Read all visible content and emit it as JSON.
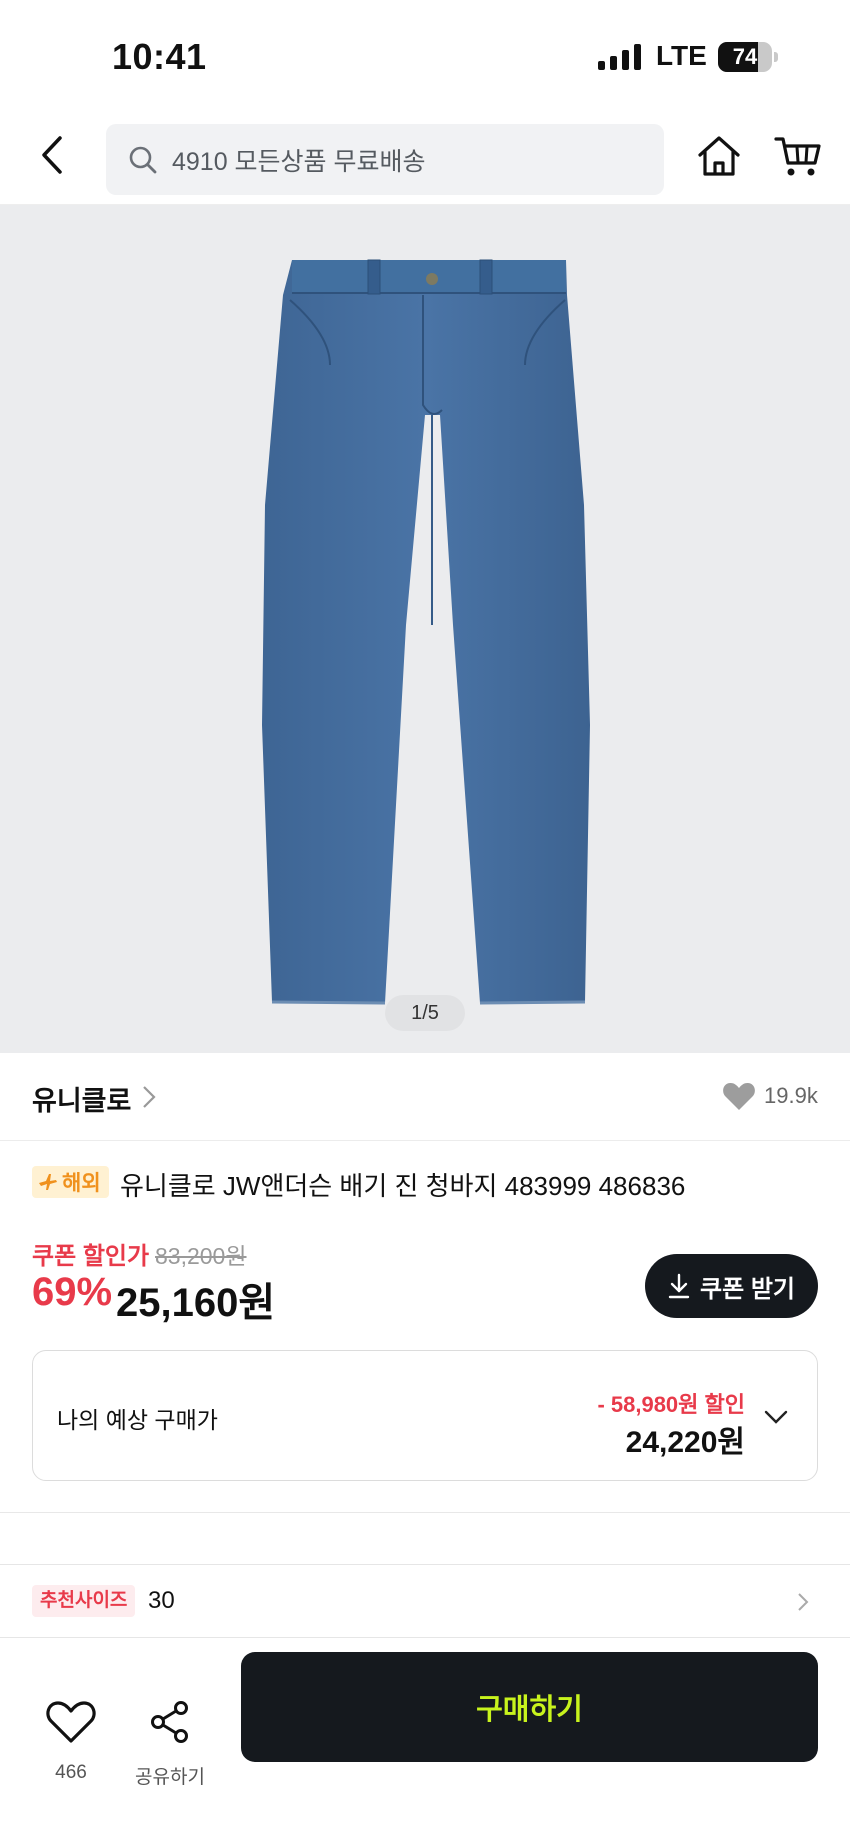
{
  "status_bar": {
    "time": "10:41",
    "network": "LTE",
    "battery": "74",
    "battery_level": 0.74
  },
  "header": {
    "search_placeholder": "4910 모든상품 무료배송",
    "icons": [
      "back-arrow-icon",
      "search-icon",
      "home-icon",
      "cart-icon"
    ]
  },
  "gallery": {
    "counter": "1/5",
    "background": "#ebecee"
  },
  "brand": {
    "name": "유니클로",
    "likes": "19.9k"
  },
  "product": {
    "badge": "해외",
    "title": "유니클로 JW앤더슨 배기 진 청바지 483999 486836"
  },
  "price": {
    "coupon_label": "쿠폰 할인가",
    "original": "83,200원",
    "discount_rate": "69%",
    "sale": "25,160원",
    "coupon_button": "쿠폰 받기"
  },
  "expected": {
    "label": "나의 예상 구매가",
    "discount": "- 58,980원 할인",
    "price": "24,220원"
  },
  "recommend": {
    "badge": "추천사이즈",
    "size": "30"
  },
  "bottom_bar": {
    "wish_count": "466",
    "share_label": "공유하기",
    "buy_label": "구매하기"
  },
  "colors": {
    "accent_red": "#e83a4a",
    "buy_button_bg": "#15191e",
    "buy_button_text": "#c8f31d",
    "overseas_badge": "#f0911d"
  }
}
